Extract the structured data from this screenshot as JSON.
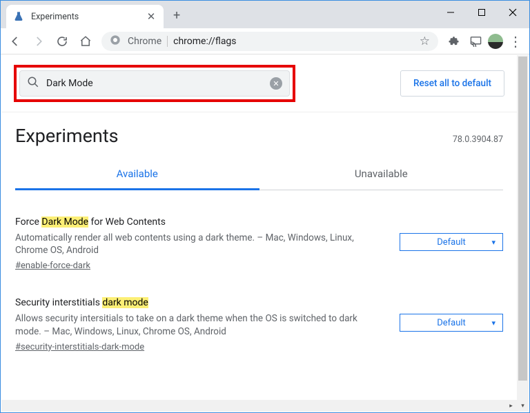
{
  "titlebar": {
    "tab_title": "Experiments",
    "close_x": "✕",
    "new_tab": "+"
  },
  "urlbar": {
    "host": "Chrome",
    "path": "chrome://flags",
    "star": "☆",
    "kebab": "⋮"
  },
  "search": {
    "value": "Dark Mode",
    "reset_label": "Reset all to default"
  },
  "heading": {
    "title": "Experiments",
    "version": "78.0.3904.87"
  },
  "tabs": {
    "available": "Available",
    "unavailable": "Unavailable"
  },
  "flags": [
    {
      "title_pre": "Force ",
      "title_mark": "Dark Mode",
      "title_post": " for Web Contents",
      "desc": "Automatically render all web contents using a dark theme. – Mac, Windows, Linux, Chrome OS, Android",
      "anchor": "#enable-force-dark",
      "select": "Default"
    },
    {
      "title_pre": "Security interstitials ",
      "title_mark": "dark mode",
      "title_post": "",
      "desc": "Allows security intersitials to take on a dark theme when the OS is switched to dark mode. – Mac, Windows, Linux, Chrome OS, Android",
      "anchor": "#security-interstitials-dark-mode",
      "select": "Default"
    }
  ]
}
